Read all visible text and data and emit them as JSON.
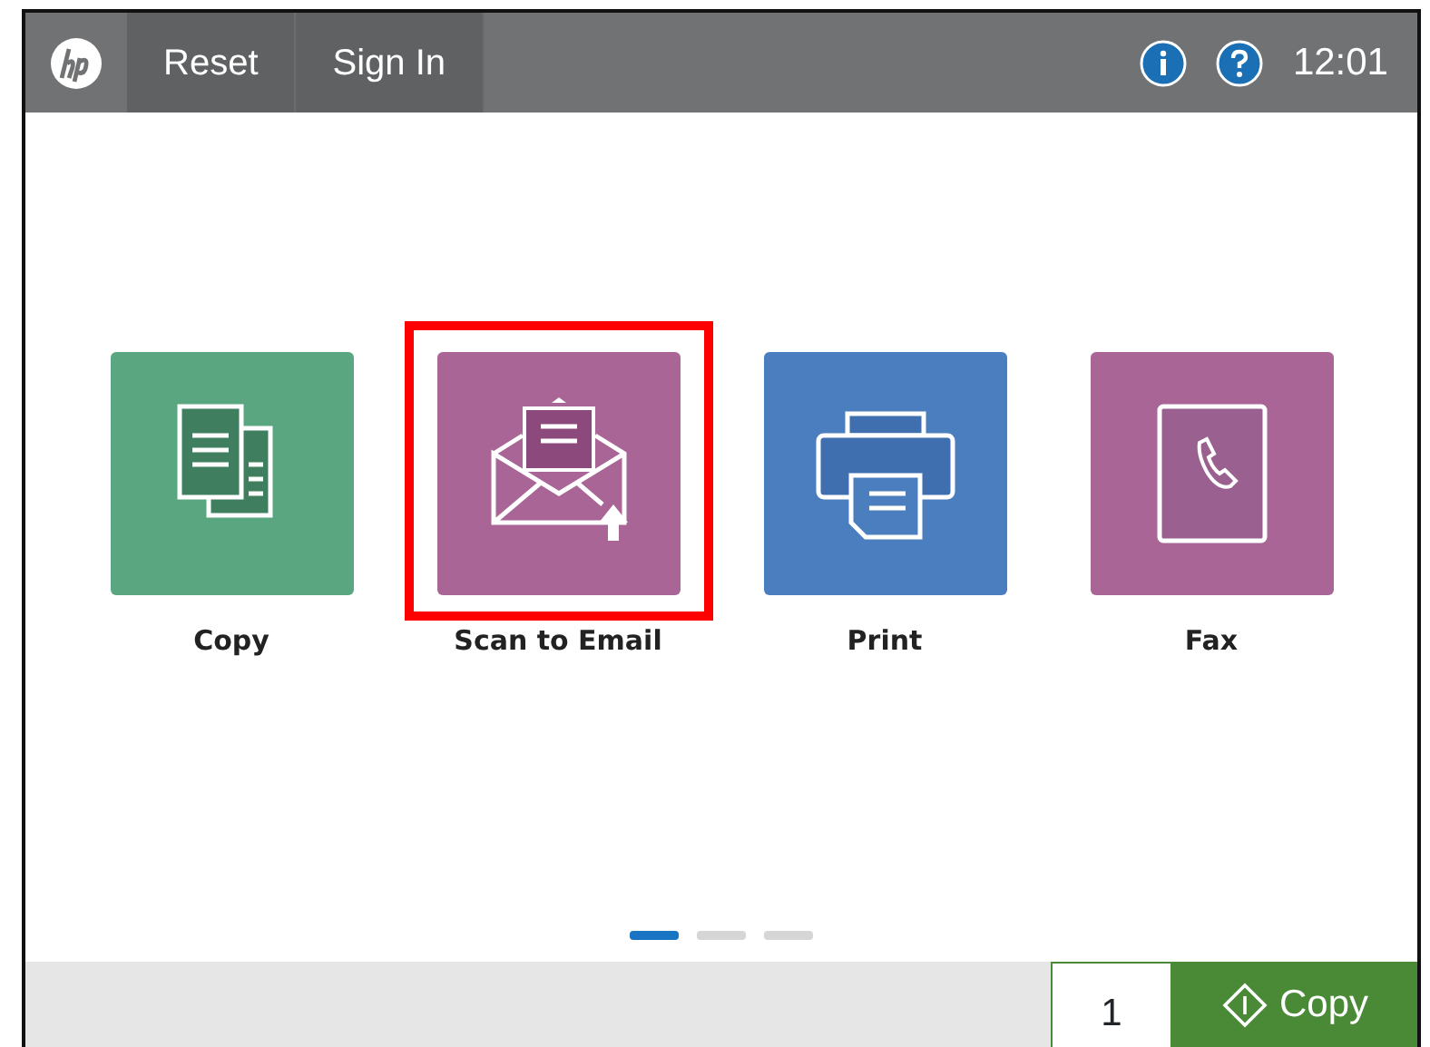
{
  "top_bar": {
    "buttons": [
      {
        "label": "Reset"
      },
      {
        "label": "Sign In"
      }
    ],
    "time": "12:01"
  },
  "apps": [
    {
      "label": "Copy",
      "kind": "copy",
      "color": "#5aa680",
      "highlighted": false
    },
    {
      "label": "Scan to Email",
      "kind": "email",
      "color": "#a86596",
      "highlighted": true
    },
    {
      "label": "Print",
      "kind": "print",
      "color": "#4a7ebf",
      "highlighted": false
    },
    {
      "label": "Fax",
      "kind": "fax",
      "color": "#a86596",
      "highlighted": false
    }
  ],
  "pages": [
    {
      "selected": true
    },
    {
      "selected": false
    },
    {
      "selected": false
    }
  ],
  "bottom_bar": {
    "copies": "1",
    "start_button": "Copy"
  }
}
